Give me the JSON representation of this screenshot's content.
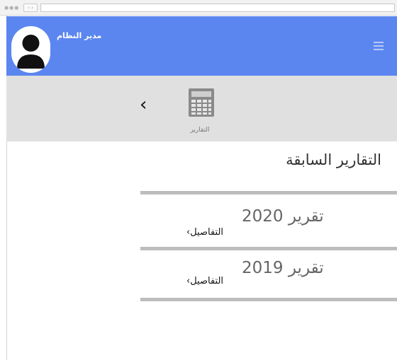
{
  "header": {
    "user_name": "مدير النظام",
    "avatar_icon": "user-avatar-icon",
    "menu_icon": "hamburger-menu-icon",
    "background_color": "#5b86f0"
  },
  "toolbar": {
    "back_icon": "chevron-left-icon",
    "reports_icon": "calculator-icon",
    "reports_label": "التقارير"
  },
  "main": {
    "section_title": "التقارير السابقة",
    "reports": [
      {
        "title": "تقرير 2020",
        "details_label": "التفاصيل›"
      },
      {
        "title": "تقرير 2019",
        "details_label": "التفاصيل›"
      }
    ]
  }
}
